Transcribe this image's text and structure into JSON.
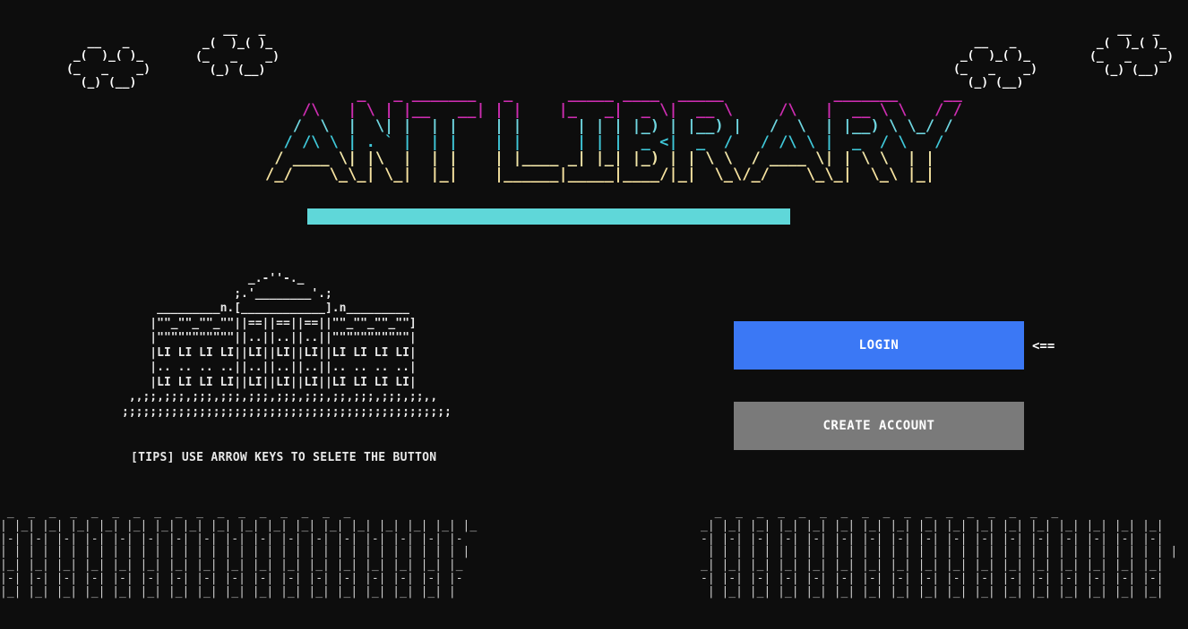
{
  "colors": {
    "background": "#0d0d0d",
    "title_line_colors": [
      "#cc2db0",
      "#6fd6e0",
      "#3fc7d8",
      "#f2e6a8",
      "#f7e3a0"
    ],
    "progress_fill": "#5fd7d9",
    "login_button": "#3b78f5",
    "create_button": "#7a7a7a",
    "text": "#ffffff"
  },
  "icons": {
    "clouds": "ascii-cloud-icon",
    "building": "ascii-library-building-icon",
    "city": "ascii-city-skyline-icon",
    "selector": "left-arrow-icon"
  },
  "clouds": [
    "   __   _\n _(  )_( )_\n(_   _    _)\n  (_) (__)",
    "    __   _\n _(  )_( )_\n(_   _    _)\n  (_) (__)",
    "   __   _\n _(  )_( )_\n(_   _    _)\n  (_) (__)",
    "    __   _\n _(  )_( )_\n(_   _    _)\n  (_) (__)"
  ],
  "title_art": [
    "          _   _ _______   _      _____ ____  _____            _______     __",
    "    /\\   | \\ | |__   __| | |    |_   _|  _ \\|  __ \\     /\\   |  __ \\ \\   / /",
    "   /  \\  |  \\| |  | |    | |      | | | |_) | |__) |   /  \\  | |__) \\ \\_/ /",
    "  / /\\ \\ | . ` |  | |    | |      | | |  _ <|  _  /   / /\\ \\ |  _  / \\   /",
    " / ____ \\| |\\  |  | |    | |____ _| |_| |_) | | \\ \\  / ____ \\| | \\ \\  | |",
    "/_/    \\_\\_| \\_|  |_|    |______|_____|____/|_|  \\_\\/_/    \\_\\_|  \\_\\ |_|"
  ],
  "progress": {
    "value": 1.0
  },
  "building_art": "                  _.-''-._\n                ;.'________'.;\n     _________n.[____________].n_________\n    |\"\"_\"\"_\"\"_\"\"||==||==||==||\"\"_\"\"_\"\"_\"\"]\n    |\"\"\"\"\"\"\"\"\"\"\"||..||..||..||\"\"\"\"\"\"\"\"\"\"\"|\n    |LI LI LI LI||LI||LI||LI||LI LI LI LI|\n    |.. .. .. ..||..||..||..||.. .. .. ..|\n    |LI LI LI LI||LI||LI||LI||LI LI LI LI|\n ,,;;,;;;,;;;,;;;,;;;,;;;,;;;,;;,;;;,;;;,;;,,\n;;;;;;;;;;;;;;;;;;;;;;;;;;;;;;;;;;;;;;;;;;;;;;;",
  "tips": "[TIPS] USE ARROW KEYS TO SELETE THE BUTTON",
  "buttons": {
    "login": "LOGIN",
    "create_account": "CREATE ACCOUNT"
  },
  "selector_arrow": "<==",
  "city_left": " _  _  _  _  _  _  _  _  _  _  _  _  _  _  _  _  _\n| |_| |_| |_| |_| |_| |_| |_| |_| |_| |_| |_| |_| |_| |_| |_| |_| |_\n|-| |-| |-| |-| |-| |-| |-| |-| |-| |-| |-| |-| |-| |-| |-| |-| |-\n| | | | | | | | | | | | | | | | | | | | | | | | | | | | | | | | | |\n|_| |_| |_| |_| |_| |_| |_| |_| |_| |_| |_| |_| |_| |_| |_| |_| |_\n|-| |-| |-| |-| |-| |-| |-| |-| |-| |-| |-| |-| |-| |-| |-| |-| |-\n|_| |_| |_| |_| |_| |_| |_| |_| |_| |_| |_| |_| |_| |_| |_| |_| |",
  "city_right": "  _  _  _  _  _  _  _  _  _  _  _  _  _  _  _  _  _\n_| |_| |_| |_| |_| |_| |_| |_| |_| |_| |_| |_| |_| |_| |_| |_| |_|\n-| |-| |-| |-| |-| |-| |-| |-| |-| |-| |-| |-| |-| |-| |-| |-| |-|\n | | | | | | | | | | | | | | | | | | | | | | | | | | | | | | | | | |\n_| |_| |_| |_| |_| |_| |_| |_| |_| |_| |_| |_| |_| |_| |_| |_| |_|\n-| |-| |-| |-| |-| |-| |-| |-| |-| |-| |-| |-| |-| |-| |-| |-| |-|\n | |_| |_| |_| |_| |_| |_| |_| |_| |_| |_| |_| |_| |_| |_| |_| |_|"
}
